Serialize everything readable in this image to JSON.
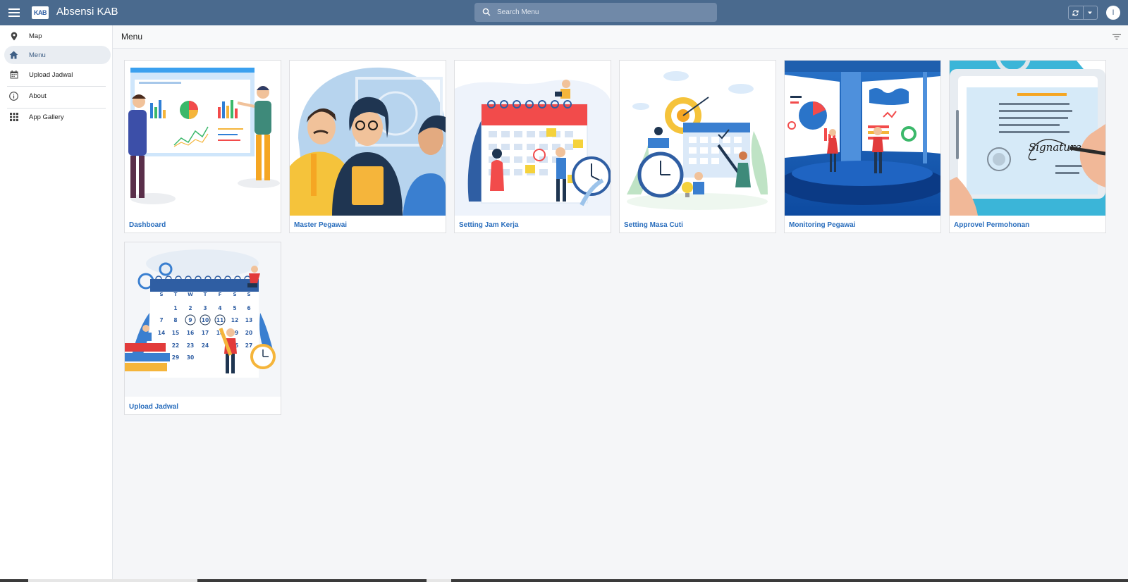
{
  "app": {
    "title": "Absensi KAB",
    "logo_text": "KAB"
  },
  "search": {
    "placeholder": "Search Menu"
  },
  "user": {
    "initial": "I"
  },
  "sidebar": {
    "items": [
      {
        "label": "Map",
        "icon": "map-pin-icon",
        "active": false
      },
      {
        "label": "Menu",
        "icon": "home-icon",
        "active": true
      },
      {
        "label": "Upload Jadwal",
        "icon": "calendar-icon",
        "active": false
      },
      {
        "label": "About",
        "icon": "info-icon",
        "active": false
      },
      {
        "label": "App Gallery",
        "icon": "grid-icon",
        "active": false
      }
    ]
  },
  "main": {
    "title": "Menu",
    "cards": [
      {
        "label": "Dashboard",
        "image": "dashboard-illustration"
      },
      {
        "label": "Master Pegawai",
        "image": "employees-illustration"
      },
      {
        "label": "Setting Jam Kerja",
        "image": "work-hours-illustration"
      },
      {
        "label": "Setting Masa Cuti",
        "image": "leave-period-illustration"
      },
      {
        "label": "Monitoring Pegawai",
        "image": "monitoring-illustration"
      },
      {
        "label": "Approvel Permohonan",
        "image": "approval-illustration"
      },
      {
        "label": "Upload Jadwal",
        "image": "schedule-calendar-illustration"
      }
    ]
  },
  "illustrations": {
    "calendar_days": [
      "S",
      "T",
      "W",
      "T",
      "F",
      "S",
      "S"
    ],
    "calendar_rows": [
      [
        "",
        "1",
        "2",
        "3",
        "4",
        "5",
        "6"
      ],
      [
        "7",
        "8",
        "9",
        "10",
        "11",
        "12",
        "13"
      ],
      [
        "14",
        "15",
        "16",
        "17",
        "18",
        "19",
        "20"
      ],
      [
        "",
        "22",
        "23",
        "24",
        "",
        "26",
        "27"
      ],
      [
        "",
        "29",
        "30",
        "",
        "",
        "",
        ""
      ]
    ],
    "signature_text": "Signature"
  },
  "colors": {
    "topbar": "#4a6a8e",
    "accent_link": "#2a6ebd",
    "active_nav": "#e9edf2"
  }
}
